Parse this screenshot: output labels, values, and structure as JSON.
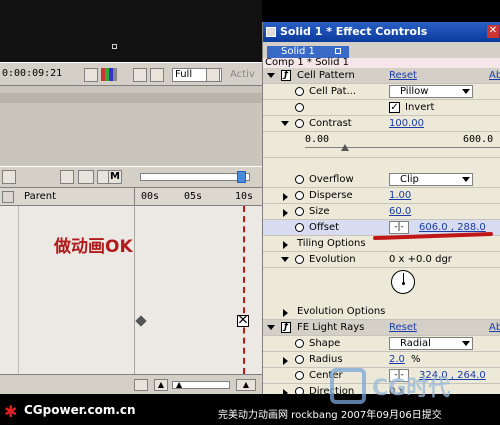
{
  "viewer": {
    "timecode": "0:00:09:21",
    "resolution": "Full",
    "active_label": "Activ"
  },
  "timeline": {
    "parent_header": "Parent",
    "ruler_labels": [
      "00s",
      "05s",
      "10s"
    ],
    "overlay_text": "做动画OK",
    "overlay_color": "#b01c1c"
  },
  "effect_controls": {
    "title": "Solid 1 * Effect Controls",
    "tab_label": "Solid 1",
    "comp_label": "Comp 1 * Solid 1",
    "cell_pattern": {
      "name": "Cell Pattern",
      "reset": "Reset",
      "about": "Ab",
      "cell_pat_label": "Cell Pat...",
      "cell_pat_value": "Pillow",
      "invert_label": "Invert",
      "contrast_label": "Contrast",
      "contrast_value": "100.00",
      "slider_min": "0.00",
      "slider_max": "600.0",
      "overflow_label": "Overflow",
      "overflow_value": "Clip",
      "disperse_label": "Disperse",
      "disperse_value": "1.00",
      "size_label": "Size",
      "size_value": "60.0",
      "offset_label": "Offset",
      "offset_value": "606.0 , 288.0",
      "tiling_label": "Tiling Options",
      "evolution_label": "Evolution",
      "evolution_value": "0 x +0.0 dgr",
      "evolution_options_label": "Evolution Options"
    },
    "light_rays": {
      "name": "FE Light Rays",
      "reset": "Reset",
      "about": "Ab",
      "shape_label": "Shape",
      "shape_value": "Radial",
      "radius_label": "Radius",
      "radius_value": "2.0",
      "radius_unit": "%",
      "center_label": "Center",
      "center_value": "324.0 , 264.0",
      "direction_label": "Direction",
      "direction_value": "0 x"
    }
  },
  "watermarks": {
    "cgpower": "CGpower.com.cn",
    "credit": "完美动力动画网 rockbang 2007年09月06日提交",
    "logo_text": "CG时代"
  },
  "colors": {
    "title_blue": "#0a3b9c",
    "link_blue": "#1a3ca8",
    "panel_bg": "#ece9d8",
    "marker_red": "#c01818"
  }
}
